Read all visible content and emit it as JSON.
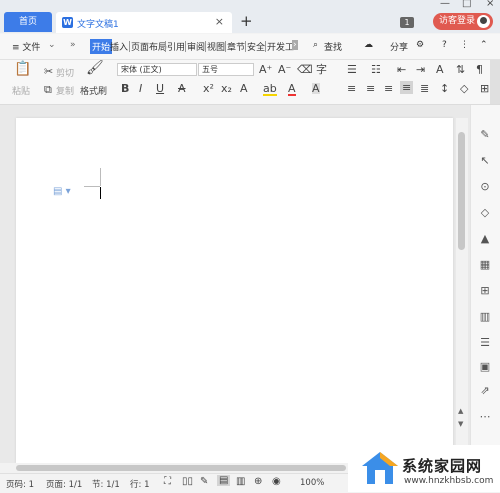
{
  "tabs": {
    "home": "首页",
    "doc": "文字文稿1",
    "new": "+"
  },
  "title_bar": {
    "badge": "1",
    "login": "访客登录"
  },
  "menu": {
    "file": "≡ 文件",
    "chevron": "»",
    "items": [
      "开始",
      "插入",
      "页面布局",
      "引用",
      "审阅",
      "视图",
      "章节",
      "安全",
      "开发工"
    ],
    "search": "查找",
    "share": "分享",
    "help": "?"
  },
  "ribbon": {
    "paste": "粘贴",
    "cut": "剪切",
    "copy": "复制",
    "format_painter": "格式刷",
    "font": "宋体 (正文)",
    "size": "五号",
    "bold": "B",
    "italic": "I",
    "underline": "U"
  },
  "status": {
    "page_num": "页码: 1",
    "pages": "页面: 1/1",
    "section": "节: 1/1",
    "line": "行: 1",
    "zoom": "100%"
  },
  "watermark": {
    "title": "系统家园网",
    "url": "www.hnzkhbsb.com"
  },
  "colors": {
    "accent": "#3d7ce8",
    "login": "#e05a50"
  }
}
